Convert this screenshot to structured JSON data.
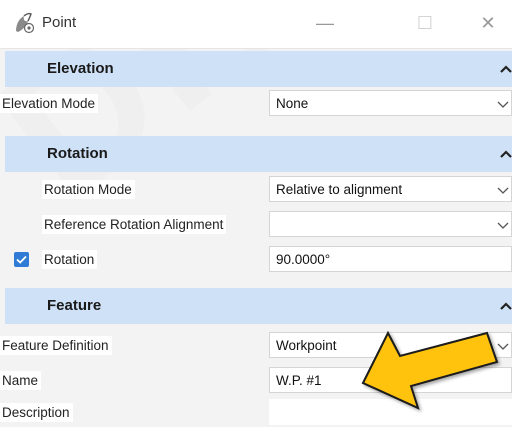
{
  "window": {
    "title": "Point",
    "minimize_glyph": "—",
    "maximize_glyph": "☐",
    "close_glyph": "✕"
  },
  "sections": {
    "elevation": {
      "title": "Elevation",
      "rows": [
        {
          "label": "Elevation Mode",
          "value": "None",
          "control": "dropdown"
        }
      ]
    },
    "rotation": {
      "title": "Rotation",
      "rows": [
        {
          "label": "Rotation Mode",
          "value": "Relative to alignment",
          "control": "dropdown"
        },
        {
          "label": "Reference Rotation Alignment",
          "value": "",
          "control": "dropdown"
        },
        {
          "label": "Rotation",
          "value": "90.0000°",
          "control": "text",
          "checked": true
        }
      ]
    },
    "feature": {
      "title": "Feature",
      "rows": [
        {
          "label": "Feature Definition",
          "value": "Workpoint",
          "control": "dropdown"
        },
        {
          "label": "Name",
          "value": "W.P. #1",
          "control": "text"
        },
        {
          "label": "Description",
          "value": "",
          "control": "text"
        }
      ]
    }
  },
  "watermark": "DRAFT",
  "colors": {
    "section_header_bg": "#cfe1f7",
    "checkbox_accent": "#2f7bd6",
    "callout_fill": "#ffc20e",
    "callout_stroke": "#1a1a1a"
  },
  "icons": {
    "app": "point-tool-icon",
    "section_toggle": "chevron-up-icon",
    "dropdown": "chevron-down-icon",
    "annotation": "callout-arrow-icon"
  }
}
